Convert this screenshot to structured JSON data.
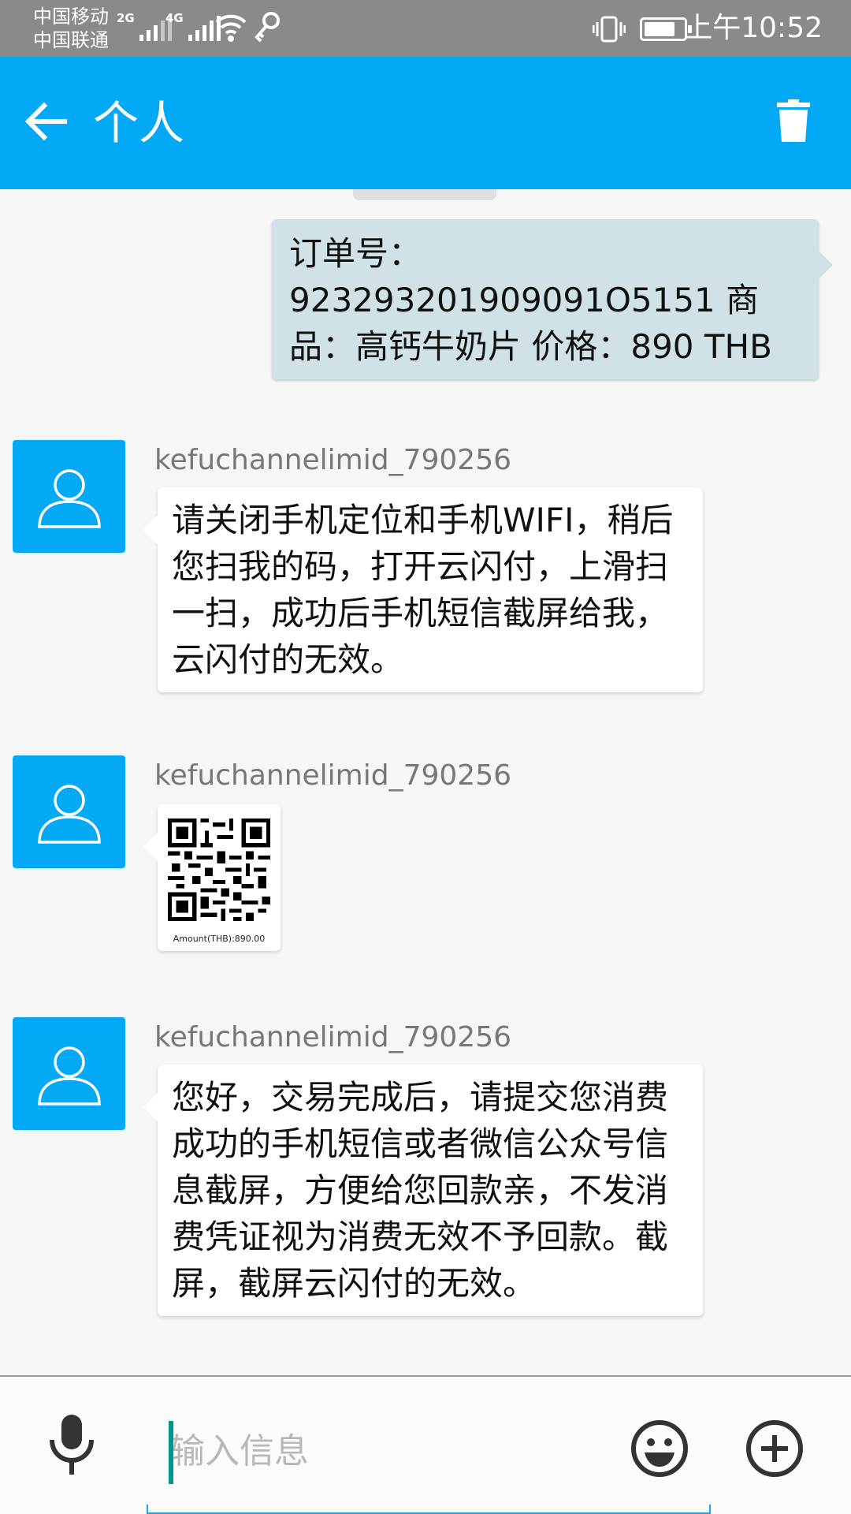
{
  "status_bar": {
    "carrier_1": "中国移动",
    "carrier_2": "中国联通",
    "network_1": "2G",
    "network_2": "4G",
    "time": "上午10:52",
    "icons": [
      "signal-icon",
      "wifi-icon",
      "key-icon",
      "vibrate-icon",
      "battery-icon"
    ]
  },
  "app_bar": {
    "title": "个人",
    "back_icon": "arrow-left-icon",
    "delete_icon": "trash-icon"
  },
  "messages": {
    "outgoing_order": "订单号：923293201909091O5151 商品：高钙牛奶片 价格：890 THB",
    "incoming": [
      {
        "sender": "kefuchannelimid_790256",
        "text": "请关闭手机定位和手机WIFI，稍后您扫我的码，打开云闪付，上滑扫一扫，成功后手机短信截屏给我，云闪付的无效。"
      },
      {
        "sender": "kefuchannelimid_790256",
        "qr_caption": "Amount(THB):890.00"
      },
      {
        "sender": "kefuchannelimid_790256",
        "text": "您好，交易完成后，请提交您消费成功的手机短信或者微信公众号信息截屏，方便给您回款亲，不发消费凭证视为消费无效不予回款。截屏，截屏云闪付的无效。"
      }
    ]
  },
  "input_bar": {
    "placeholder": "输入信息",
    "value": "",
    "icons": [
      "microphone-icon",
      "emoji-icon",
      "plus-icon"
    ]
  },
  "colors": {
    "app_bar": "#03a9f4",
    "status_bar": "#8a8a8a",
    "outgoing_bubble": "#d1e2e6",
    "incoming_bubble": "#ffffff",
    "avatar": "#03a9f4",
    "cursor": "#009688"
  }
}
